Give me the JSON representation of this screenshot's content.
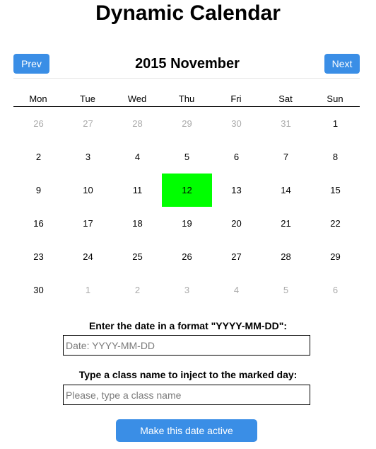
{
  "app": {
    "title": "Dynamic Calendar"
  },
  "nav": {
    "prev_label": "Prev",
    "next_label": "Next",
    "month_title": "2015 November"
  },
  "calendar": {
    "weekdays": [
      "Mon",
      "Tue",
      "Wed",
      "Thu",
      "Fri",
      "Sat",
      "Sun"
    ],
    "weeks": [
      [
        {
          "day": "26",
          "current_month": false
        },
        {
          "day": "27",
          "current_month": false
        },
        {
          "day": "28",
          "current_month": false
        },
        {
          "day": "29",
          "current_month": false
        },
        {
          "day": "30",
          "current_month": false
        },
        {
          "day": "31",
          "current_month": false
        },
        {
          "day": "1",
          "current_month": true
        }
      ],
      [
        {
          "day": "2",
          "current_month": true
        },
        {
          "day": "3",
          "current_month": true
        },
        {
          "day": "4",
          "current_month": true
        },
        {
          "day": "5",
          "current_month": true
        },
        {
          "day": "6",
          "current_month": true
        },
        {
          "day": "7",
          "current_month": true
        },
        {
          "day": "8",
          "current_month": true
        }
      ],
      [
        {
          "day": "9",
          "current_month": true
        },
        {
          "day": "10",
          "current_month": true
        },
        {
          "day": "11",
          "current_month": true
        },
        {
          "day": "12",
          "current_month": true,
          "active": true
        },
        {
          "day": "13",
          "current_month": true
        },
        {
          "day": "14",
          "current_month": true
        },
        {
          "day": "15",
          "current_month": true
        }
      ],
      [
        {
          "day": "16",
          "current_month": true
        },
        {
          "day": "17",
          "current_month": true
        },
        {
          "day": "18",
          "current_month": true
        },
        {
          "day": "19",
          "current_month": true
        },
        {
          "day": "20",
          "current_month": true
        },
        {
          "day": "21",
          "current_month": true
        },
        {
          "day": "22",
          "current_month": true
        }
      ],
      [
        {
          "day": "23",
          "current_month": true
        },
        {
          "day": "24",
          "current_month": true
        },
        {
          "day": "25",
          "current_month": true
        },
        {
          "day": "26",
          "current_month": true
        },
        {
          "day": "27",
          "current_month": true
        },
        {
          "day": "28",
          "current_month": true
        },
        {
          "day": "29",
          "current_month": true
        }
      ],
      [
        {
          "day": "30",
          "current_month": true
        },
        {
          "day": "1",
          "current_month": false
        },
        {
          "day": "2",
          "current_month": false
        },
        {
          "day": "3",
          "current_month": false
        },
        {
          "day": "4",
          "current_month": false
        },
        {
          "day": "5",
          "current_month": false
        },
        {
          "day": "6",
          "current_month": false
        }
      ]
    ]
  },
  "form": {
    "date_label": "Enter the date in a format \"YYYY-MM-DD\":",
    "date_value": "",
    "date_placeholder": "Date: YYYY-MM-DD",
    "class_label": "Type a class name to inject to the marked day:",
    "class_value": "",
    "class_placeholder": "Please, type a class name",
    "submit_label": "Make this date active"
  },
  "colors": {
    "button_blue": "#3a8ee6",
    "active_day": "#00ff00",
    "muted_day": "#aaaaaa"
  }
}
